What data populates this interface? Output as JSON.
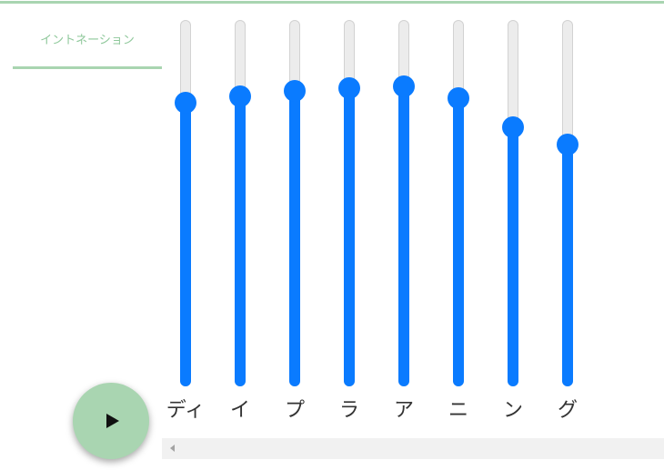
{
  "theme": {
    "accent": "#0a7bff",
    "green": "#a9d5b1",
    "tab_text": "#8fc89b",
    "track": "#ececec",
    "scrollbar": "#f1f1f1"
  },
  "tabs": [
    {
      "label": "イントネーション",
      "active": true
    }
  ],
  "sliders": [
    {
      "label": "ディ",
      "level": 0.774
    },
    {
      "label": "イ",
      "level": 0.792
    },
    {
      "label": "プ",
      "level": 0.806
    },
    {
      "label": "ラ",
      "level": 0.814
    },
    {
      "label": "ア",
      "level": 0.819
    },
    {
      "label": "ニ",
      "level": 0.787
    },
    {
      "label": "ン",
      "level": 0.707
    },
    {
      "label": "グ",
      "level": 0.66
    }
  ],
  "play_button": {
    "icon": "play-icon"
  },
  "scrollbar": {
    "left_arrow_icon": "scroll-left-arrow-icon"
  }
}
